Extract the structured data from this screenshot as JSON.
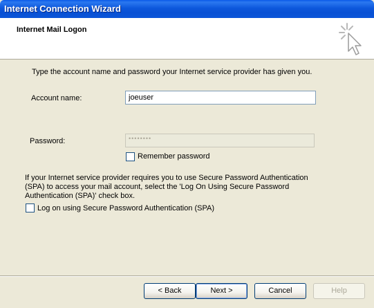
{
  "window": {
    "title": "Internet Connection Wizard"
  },
  "header": {
    "title": "Internet Mail Logon",
    "graphic_icon": "wizard-cursor-sparkle-icon"
  },
  "intro_text": "Type the account name and password your Internet service provider has given you.",
  "account": {
    "label": "Account name:",
    "value": "joeuser"
  },
  "password": {
    "label": "Password:",
    "value": "••••••••"
  },
  "remember_password": {
    "label": "Remember password",
    "checked": false
  },
  "spa_info": {
    "line1": "If your Internet service provider requires you to use Secure Password Authentication",
    "line2": "(SPA) to access your mail account, select the 'Log On Using Secure Password",
    "line3": "Authentication (SPA)' check box."
  },
  "spa_checkbox": {
    "label": "Log on using Secure Password Authentication (SPA)",
    "checked": false
  },
  "buttons": {
    "back": "< Back",
    "next": "Next >",
    "cancel": "Cancel",
    "help": "Help"
  },
  "colors": {
    "titlebar": "#0a5ae8",
    "dialog_bg": "#ece9d8",
    "button_border": "#003c74"
  }
}
